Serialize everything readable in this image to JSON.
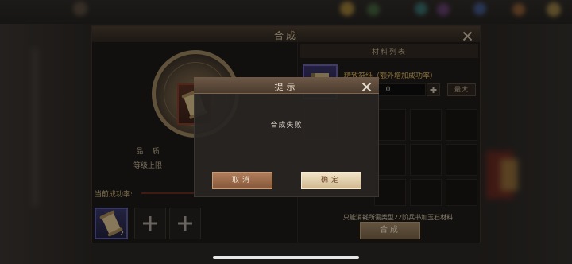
{
  "synthesis_panel": {
    "title": "合成",
    "close_icon": "close-icon",
    "target_item_icon": "scroll-card-icon",
    "quality_label": "品    质",
    "level_cap_label": "等级上限",
    "success_rate_label": "当前成功率:",
    "slots": [
      {
        "icon": "scroll-icon",
        "count": "2"
      },
      {
        "icon": "plus-icon"
      },
      {
        "icon": "plus-icon"
      }
    ],
    "materials": {
      "title": "材料列表",
      "item_icon": "book-icon",
      "item_name": "精致符纸（额外增加成功率）",
      "quantity": "0",
      "increment_icon": "plus-icon",
      "max_label": "最大"
    },
    "hint": "只能消耗所需类型22阶兵书加玉石材料",
    "synthesize_label": "合成"
  },
  "dialog": {
    "title": "提示",
    "close_icon": "close-icon",
    "message": "合成失败",
    "cancel_label": "取消",
    "confirm_label": "确定"
  },
  "colors": {
    "dialog_header": "#5b4838",
    "cancel_button": "#9c6a4a",
    "confirm_button": "#e2d0ac",
    "item_name": "#e0b860"
  }
}
